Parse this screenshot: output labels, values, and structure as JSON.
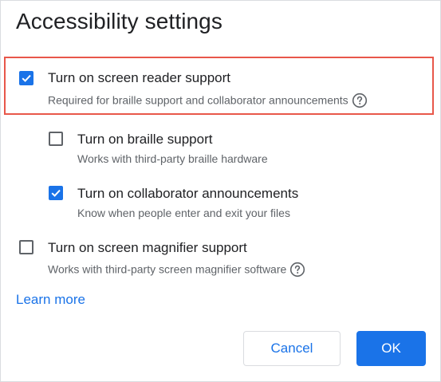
{
  "dialog": {
    "title": "Accessibility settings"
  },
  "options": [
    {
      "label": "Turn on screen reader support",
      "description": "Required for braille support and collaborator announcements",
      "checked": true,
      "help_icon": "question-circle-icon"
    },
    {
      "label": "Turn on braille support",
      "description": "Works with third-party braille hardware",
      "checked": false
    },
    {
      "label": "Turn on collaborator announcements",
      "description": "Know when people enter and exit your files",
      "checked": true
    },
    {
      "label": "Turn on screen magnifier support",
      "description": "Works with third-party screen magnifier software",
      "checked": false,
      "help_icon": "question-circle-icon"
    }
  ],
  "learn_more": "Learn more",
  "buttons": {
    "cancel": "Cancel",
    "ok": "OK"
  },
  "colors": {
    "accent": "#1a73e8",
    "highlight_border": "#e8574a"
  }
}
